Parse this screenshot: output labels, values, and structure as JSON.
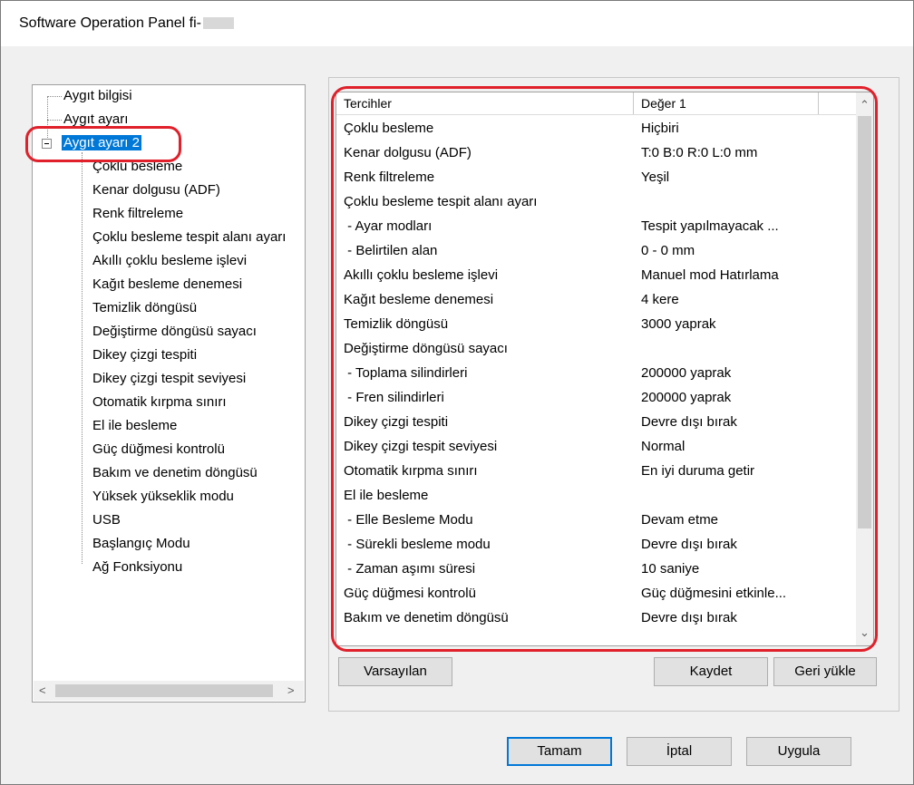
{
  "window": {
    "title": "Software Operation Panel fi-"
  },
  "tree": {
    "items": [
      {
        "label": "Aygıt bilgisi"
      },
      {
        "label": "Aygıt ayarı"
      },
      {
        "label": "Aygıt ayarı 2",
        "selected": true
      },
      {
        "label": "Çoklu besleme"
      },
      {
        "label": "Kenar dolgusu (ADF)"
      },
      {
        "label": "Renk filtreleme"
      },
      {
        "label": "Çoklu besleme tespit alanı ayarı"
      },
      {
        "label": "Akıllı çoklu besleme işlevi"
      },
      {
        "label": "Kağıt besleme denemesi"
      },
      {
        "label": "Temizlik döngüsü"
      },
      {
        "label": "Değiştirme döngüsü sayacı"
      },
      {
        "label": "Dikey çizgi tespiti"
      },
      {
        "label": "Dikey çizgi tespit seviyesi"
      },
      {
        "label": "Otomatik kırpma sınırı"
      },
      {
        "label": "El ile besleme"
      },
      {
        "label": "Güç düğmesi kontrolü"
      },
      {
        "label": "Bakım ve denetim döngüsü"
      },
      {
        "label": "Yüksek yükseklik modu"
      },
      {
        "label": "USB"
      },
      {
        "label": "Başlangıç Modu"
      },
      {
        "label": "Ağ Fonksiyonu"
      }
    ]
  },
  "list": {
    "columns": [
      "Tercihler",
      "Değer 1"
    ],
    "rows": [
      {
        "name": "Çoklu besleme",
        "value": "Hiçbiri"
      },
      {
        "name": "Kenar dolgusu (ADF)",
        "value": "T:0 B:0 R:0 L:0 mm"
      },
      {
        "name": "Renk filtreleme",
        "value": "Yeşil"
      },
      {
        "name": "Çoklu besleme tespit alanı ayarı",
        "value": ""
      },
      {
        "name": " - Ayar modları",
        "value": "Tespit yapılmayacak ..."
      },
      {
        "name": " - Belirtilen alan",
        "value": "0 - 0 mm"
      },
      {
        "name": "Akıllı çoklu besleme işlevi",
        "value": "Manuel mod  Hatırlama"
      },
      {
        "name": "Kağıt besleme denemesi",
        "value": "4 kere"
      },
      {
        "name": "Temizlik döngüsü",
        "value": "3000 yaprak"
      },
      {
        "name": "Değiştirme döngüsü sayacı",
        "value": ""
      },
      {
        "name": " - Toplama silindirleri",
        "value": "200000 yaprak"
      },
      {
        "name": " - Fren silindirleri",
        "value": "200000 yaprak"
      },
      {
        "name": "Dikey çizgi tespiti",
        "value": "Devre dışı bırak"
      },
      {
        "name": "Dikey çizgi tespit seviyesi",
        "value": "Normal"
      },
      {
        "name": "Otomatik kırpma sınırı",
        "value": "En iyi duruma getir"
      },
      {
        "name": "El ile besleme",
        "value": ""
      },
      {
        "name": " - Elle Besleme Modu",
        "value": "Devam etme"
      },
      {
        "name": " - Sürekli besleme modu",
        "value": "Devre dışı bırak"
      },
      {
        "name": " - Zaman aşımı süresi",
        "value": "10 saniye"
      },
      {
        "name": "Güç düğmesi kontrolü",
        "value": "Güç düğmesini etkinle..."
      },
      {
        "name": "Bakım ve denetim döngüsü",
        "value": "Devre dışı bırak"
      }
    ]
  },
  "buttons": {
    "defaults": "Varsayılan",
    "save": "Kaydet",
    "reload": "Geri yükle",
    "ok": "Tamam",
    "cancel": "İptal",
    "apply": "Uygula"
  },
  "colors": {
    "selection": "#0078d7",
    "highlight_oval": "#e0202a"
  }
}
